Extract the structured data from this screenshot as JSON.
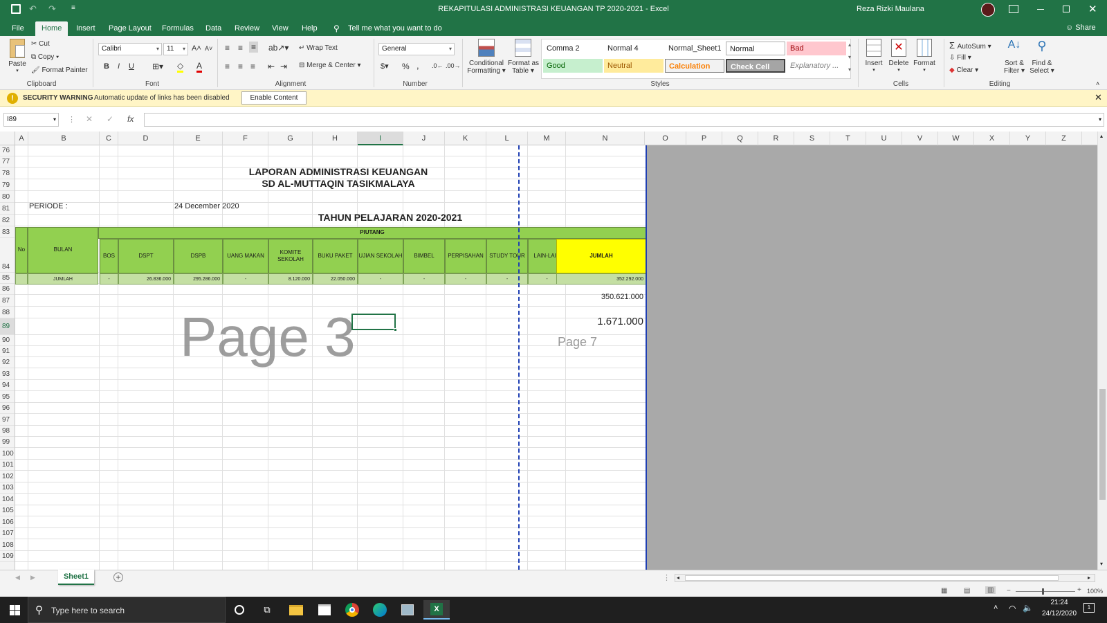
{
  "window": {
    "title": "REKAPITULASI ADMINISTRASI KEUANGAN TP 2020-2021  -  Excel",
    "user": "Reza Rizki Maulana"
  },
  "menu": {
    "tabs": [
      "File",
      "Home",
      "Insert",
      "Page Layout",
      "Formulas",
      "Data",
      "Review",
      "View",
      "Help"
    ],
    "tell_me": "Tell me what you want to do",
    "share": "Share"
  },
  "ribbon": {
    "clipboard": {
      "paste": "Paste",
      "cut": "Cut",
      "copy": "Copy",
      "format_painter": "Format Painter",
      "label": "Clipboard"
    },
    "font": {
      "name": "Calibri",
      "size": "11",
      "bold": "B",
      "italic": "I",
      "underline": "U",
      "label": "Font"
    },
    "alignment": {
      "wrap_text": "Wrap Text",
      "merge_center": "Merge & Center",
      "label": "Alignment"
    },
    "number": {
      "format": "General",
      "percent": "%",
      "comma": ",",
      "label": "Number"
    },
    "styles": {
      "conditional": "Conditional",
      "conditional2": "Formatting",
      "format_table": "Format as",
      "format_table2": "Table",
      "label": "Styles",
      "cells": [
        {
          "text": "Comma 2",
          "bg": "#ffffff",
          "fg": "#222222"
        },
        {
          "text": "Normal 4",
          "bg": "#ffffff",
          "fg": "#222222"
        },
        {
          "text": "Normal_Sheet1",
          "bg": "#ffffff",
          "fg": "#222222"
        },
        {
          "text": "Normal",
          "bg": "#ffffff",
          "fg": "#222222"
        },
        {
          "text": "Bad",
          "bg": "#ffc7ce",
          "fg": "#9c0006"
        },
        {
          "text": "Good",
          "bg": "#c6efce",
          "fg": "#006100"
        },
        {
          "text": "Neutral",
          "bg": "#ffeb9c",
          "fg": "#9c5700"
        },
        {
          "text": "Calculation",
          "bg": "#f2f2f2",
          "fg": "#fa7d00"
        },
        {
          "text": "Check Cell",
          "bg": "#a5a5a5",
          "fg": "#ffffff"
        },
        {
          "text": "Explanatory ...",
          "bg": "#ffffff",
          "fg": "#7f7f7f"
        }
      ]
    },
    "cells": {
      "insert": "Insert",
      "delete": "Delete",
      "format": "Format",
      "label": "Cells"
    },
    "editing": {
      "autosum": "AutoSum",
      "fill": "Fill",
      "clear": "Clear",
      "sort": "Sort &",
      "sort2": "Filter",
      "find": "Find &",
      "find2": "Select",
      "label": "Editing"
    }
  },
  "security": {
    "title": "SECURITY WARNING",
    "message": "Automatic update of links has been disabled",
    "button": "Enable Content"
  },
  "formula_bar": {
    "name_box": "I89",
    "fx": "fx",
    "content": ""
  },
  "columns": [
    "A",
    "B",
    "C",
    "D",
    "E",
    "F",
    "G",
    "H",
    "I",
    "J",
    "K",
    "L",
    "M",
    "N",
    "O",
    "P",
    "Q",
    "R",
    "S",
    "T",
    "U",
    "V",
    "W",
    "X",
    "Y",
    "Z"
  ],
  "rows": [
    "76",
    "77",
    "78",
    "79",
    "80",
    "81",
    "82",
    "83",
    "84",
    "85",
    "86",
    "87",
    "88",
    "89",
    "90",
    "91",
    "92",
    "93",
    "94",
    "95",
    "96",
    "97",
    "98",
    "99",
    "100",
    "101",
    "102",
    "103",
    "104",
    "105",
    "106",
    "107",
    "108",
    "109"
  ],
  "sheet": {
    "title1": "LAPORAN ADMINISTRASI KEUANGAN",
    "title2": "SD AL-MUTTAQIN TASIKMALAYA",
    "periode_label": "PERIODE :",
    "periode_value": "24 December 2020",
    "tahun": "TAHUN PELAJARAN 2020-2021",
    "piutang": "PIUTANG",
    "no": "No",
    "bulan": "BULAN",
    "headers": [
      "BOS",
      "DSPT",
      "DSPB",
      "UANG MAKAN",
      "KOMITE SEKOLAH",
      "BUKU PAKET",
      "UJIAN SEKOLAH",
      "BIMBEL",
      "PERPISAHAN",
      "STUDY TOUR",
      "LAIN-LAIN"
    ],
    "jumlah_header": "JUMLAH",
    "jumlah_label": "JUMLAH",
    "totals": [
      "-",
      "26.836.000",
      "295.286.000",
      "-",
      "8.120.000",
      "22.050.000",
      "-",
      "-",
      "-",
      "-",
      "-"
    ],
    "jumlah_total": "352.292.000",
    "n87": "350.621.000",
    "n89": "1.671.000",
    "page3": "Page 3",
    "page7": "Page 7"
  },
  "sheet_tabs": {
    "active": "Sheet1"
  },
  "status": {
    "zoom": "100%"
  },
  "taskbar": {
    "search": "Type here to search",
    "time": "21:24",
    "date": "24/12/2020"
  }
}
